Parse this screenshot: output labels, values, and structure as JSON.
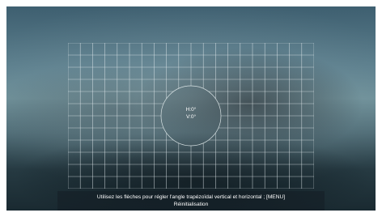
{
  "keystone": {
    "horizontal_readout": "H:0°",
    "vertical_readout": "V:0°",
    "horizontal_angle_deg": 0,
    "vertical_angle_deg": 0
  },
  "instructions": {
    "line1": "Utilisez les flèches pour régler l'angle trapézoïdal vertical et horizontal ; [MENU]",
    "line2": "Réinitialisation"
  },
  "colors": {
    "grid_line": "#e6eef0",
    "text": "#ffffff"
  }
}
